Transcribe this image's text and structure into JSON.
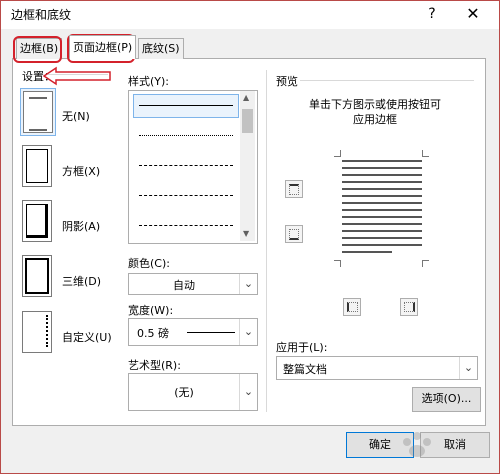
{
  "window": {
    "title": "边框和底纹",
    "help": "?",
    "close": "✕"
  },
  "tabs": [
    {
      "label": "边框(B)"
    },
    {
      "label": "页面边框(P)"
    },
    {
      "label": "底纹(S)"
    }
  ],
  "setting": {
    "label": "设置：",
    "presets": [
      {
        "label": "无(N)"
      },
      {
        "label": "方框(X)"
      },
      {
        "label": "阴影(A)"
      },
      {
        "label": "三维(D)"
      },
      {
        "label": "自定义(U)"
      }
    ]
  },
  "style": {
    "label": "样式(Y):",
    "lines": [
      "solid",
      "dotted",
      "dashed",
      "dashed",
      "dash-dot"
    ]
  },
  "color": {
    "label": "颜色(C):",
    "value": "自动"
  },
  "width": {
    "label": "宽度(W):",
    "value": "0.5 磅"
  },
  "art": {
    "label": "艺术型(R):",
    "value": "(无)"
  },
  "preview": {
    "label": "预览",
    "hint_line1": "单击下方图示或使用按钮可",
    "hint_line2": "应用边框"
  },
  "apply_to": {
    "label": "应用于(L):",
    "value": "整篇文档"
  },
  "buttons": {
    "options": "选项(O)...",
    "ok": "确定",
    "cancel": "取消"
  },
  "colors": {
    "highlight": "#d4212b",
    "selection": "#eaf3fc"
  }
}
